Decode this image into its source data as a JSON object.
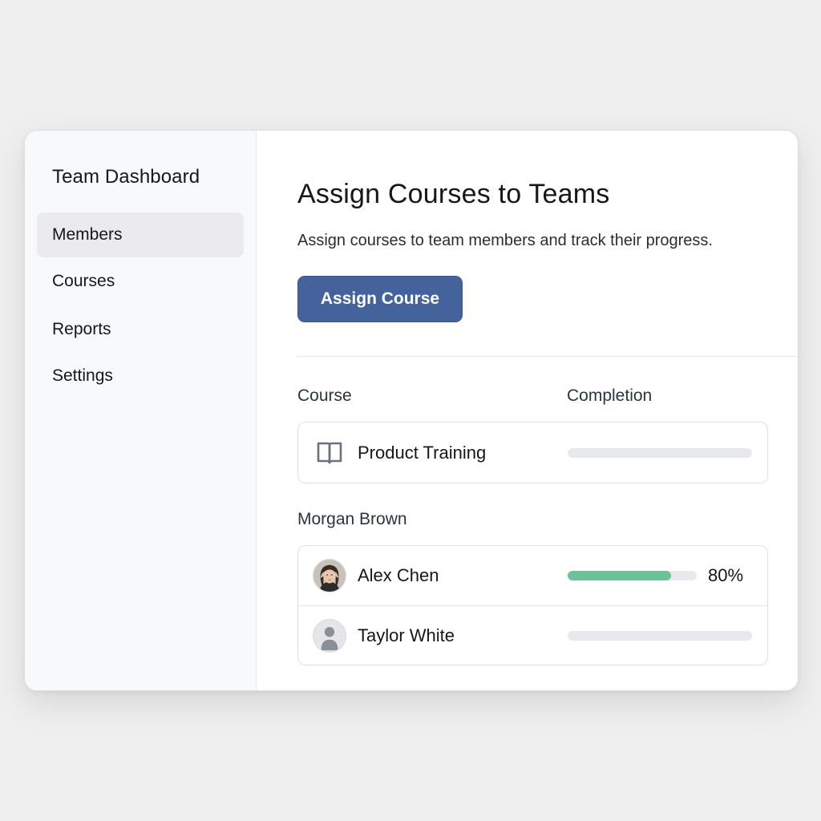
{
  "sidebar": {
    "title": "Team Dashboard",
    "items": [
      {
        "label": "Members",
        "active": true
      },
      {
        "label": "Courses",
        "active": false
      },
      {
        "label": "Reports",
        "active": false
      },
      {
        "label": "Settings",
        "active": false
      }
    ]
  },
  "main": {
    "title": "Assign Courses to Teams",
    "subtitle": "Assign courses to team members and track their progress.",
    "assign_button_label": "Assign Course",
    "columns": {
      "course": "Course",
      "completion": "Completion"
    },
    "course_row": {
      "icon": "book-icon",
      "name": "Product Training",
      "progress": 0
    },
    "group_label": "Morgan Brown",
    "members": [
      {
        "name": "Alex Chen",
        "avatar": "photo-avatar",
        "progress": 0.8,
        "percent_label": "80%"
      },
      {
        "name": "Taylor White",
        "avatar": "placeholder-avatar",
        "progress": 0,
        "percent_label": ""
      }
    ]
  },
  "colors": {
    "accent": "#44639d",
    "progress_fill": "#6cc196",
    "progress_track": "#e8e9ec",
    "active_nav": "#ebebee"
  }
}
